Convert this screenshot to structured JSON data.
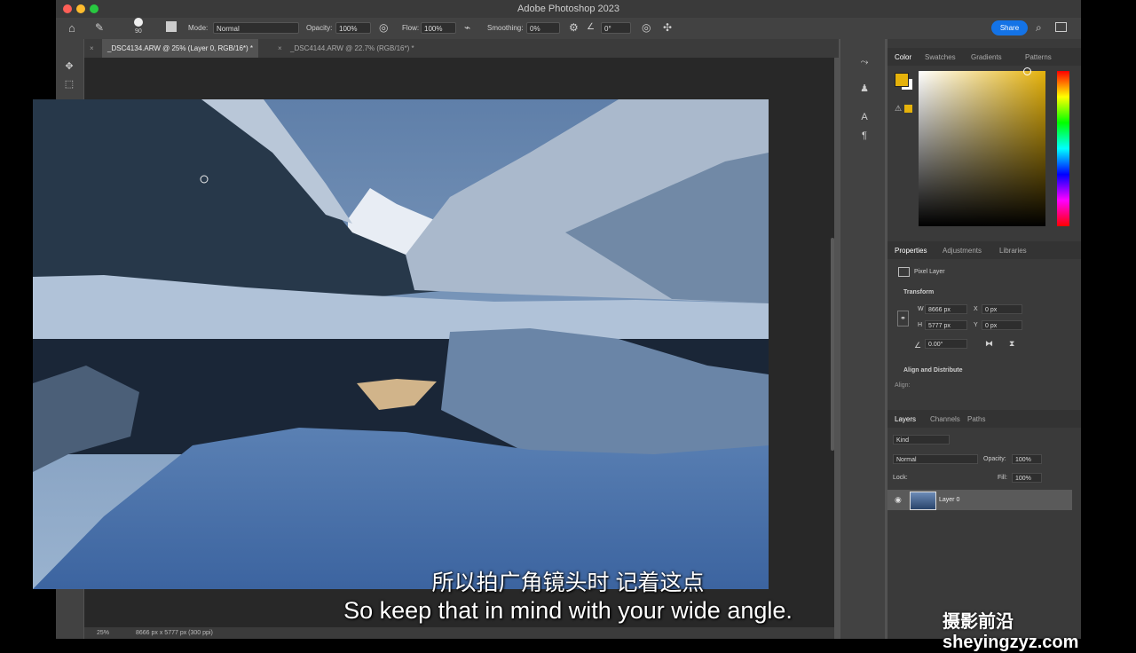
{
  "window": {
    "title": "Adobe Photoshop 2023"
  },
  "options": {
    "brush_size": "90",
    "mode_label": "Mode:",
    "mode_value": "Normal",
    "opacity_label": "Opacity:",
    "opacity_value": "100%",
    "flow_label": "Flow:",
    "flow_value": "100%",
    "smoothing_label": "Smoothing:",
    "smoothing_value": "0%",
    "angle_value": "0°",
    "share_label": "Share"
  },
  "tabs": [
    {
      "label": "_DSC4134.ARW @ 25% (Layer 0, RGB/16*) *",
      "active": true
    },
    {
      "label": "_DSC4144.ARW @ 22.7% (RGB/16*) *",
      "active": false
    }
  ],
  "status": {
    "zoom": "25%",
    "doc_info": "8666 px x 5777 px (300 ppi)"
  },
  "color_panel": {
    "tabs": [
      "Color",
      "Swatches",
      "Gradients",
      "Patterns"
    ],
    "fg": "#e5b20b",
    "bg": "#ffffff"
  },
  "properties_panel": {
    "tabs": [
      "Properties",
      "Adjustments",
      "Libraries"
    ],
    "type": "Pixel Layer",
    "transform_label": "Transform",
    "w_label": "W",
    "w_value": "8666 px",
    "h_label": "H",
    "h_value": "5777 px",
    "x_label": "X",
    "x_value": "0 px",
    "y_label": "Y",
    "y_value": "0 px",
    "angle": "0.00°",
    "align_label": "Align and Distribute",
    "align_sub": "Align:"
  },
  "layers_panel": {
    "tabs": [
      "Layers",
      "Channels",
      "Paths"
    ],
    "kind": "Kind",
    "blend": "Normal",
    "opacity_label": "Opacity:",
    "opacity_value": "100%",
    "lock_label": "Lock:",
    "fill_label": "Fill:",
    "fill_value": "100%",
    "layer_name": "Layer 0"
  },
  "subtitles": {
    "zh": "所以拍广角镜头时 记着这点",
    "en": "So keep that in mind with your wide angle."
  },
  "watermark": "摄影前沿 sheyingzyz.com"
}
